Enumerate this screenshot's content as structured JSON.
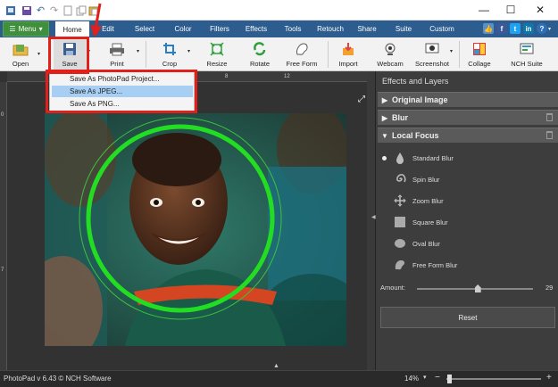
{
  "quick_access": [
    "save-icon",
    "undo-icon",
    "redo-icon",
    "cut-icon",
    "copy-icon",
    "paste-icon"
  ],
  "window_controls": [
    "minimize",
    "maximize",
    "close"
  ],
  "menu_button": "Menu",
  "tabs": [
    "Home",
    "Edit",
    "Select",
    "Color",
    "Filters",
    "Effects",
    "Tools",
    "Retouch",
    "Share",
    "Suite",
    "Custom"
  ],
  "social": [
    "thumbs-up-icon",
    "facebook-icon",
    "twitter-icon",
    "linkedin-icon",
    "help-icon"
  ],
  "toolbar": {
    "open": "Open",
    "save": "Save",
    "print": "Print",
    "crop": "Crop",
    "resize": "Resize",
    "rotate": "Rotate",
    "free_form": "Free Form",
    "import": "Import",
    "webcam": "Webcam",
    "screenshot": "Screenshot",
    "collage": "Collage",
    "nch_suite": "NCH Suite"
  },
  "save_menu": {
    "items": [
      "Save As PhotoPad Project...",
      "Save As JPEG...",
      "Save As PNG..."
    ],
    "highlighted_index": 1
  },
  "ruler": {
    "h_ticks": [
      "8",
      "12"
    ],
    "v_ticks": [
      "0",
      "7"
    ]
  },
  "panel": {
    "title": "Effects and Layers",
    "sections": [
      "Original Image",
      "Blur",
      "Local Focus"
    ],
    "blur_types": [
      "Standard Blur",
      "Spin Blur",
      "Zoom Blur",
      "Square Blur",
      "Oval Blur",
      "Free Form Blur"
    ],
    "amount_label": "Amount:",
    "amount_value": "29",
    "amount_fraction": 0.29,
    "reset_label": "Reset"
  },
  "status": {
    "version": "PhotoPad v 6.43 © NCH Software",
    "zoom": "14%"
  },
  "colors": {
    "menubar": "#2d5c8e",
    "focus_ring": "#22dd22",
    "highlight": "#a7cff4",
    "annotation": "#e0201b"
  }
}
